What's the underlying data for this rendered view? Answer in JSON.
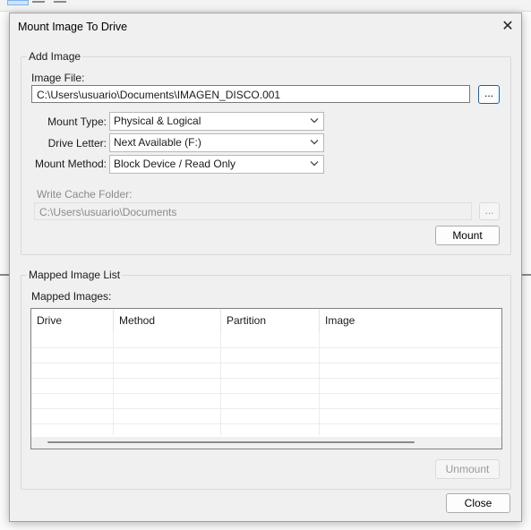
{
  "dialog": {
    "title": "Mount Image To Drive",
    "close_icon": "close-icon"
  },
  "add_image": {
    "legend": "Add Image",
    "image_file_label": "Image File:",
    "image_file_value": "C:\\Users\\usuario\\Documents\\IMAGEN_DISCO.001",
    "browse_label": "...",
    "mount_type_label": "Mount Type:",
    "mount_type_value": "Physical & Logical",
    "drive_letter_label": "Drive Letter:",
    "drive_letter_value": "Next Available (F:)",
    "mount_method_label": "Mount Method:",
    "mount_method_value": "Block Device / Read Only",
    "write_cache_label": "Write Cache Folder:",
    "write_cache_value": "C:\\Users\\usuario\\Documents",
    "write_cache_browse_label": "...",
    "mount_button": "Mount"
  },
  "mapped": {
    "legend": "Mapped Image List",
    "list_label": "Mapped Images:",
    "columns": [
      "Drive",
      "Method",
      "Partition",
      "Image"
    ],
    "rows": [],
    "unmount_button": "Unmount"
  },
  "footer": {
    "close_button": "Close"
  },
  "colors": {
    "dialog_bg": "#f0f0f0",
    "accent": "#0067c0"
  }
}
